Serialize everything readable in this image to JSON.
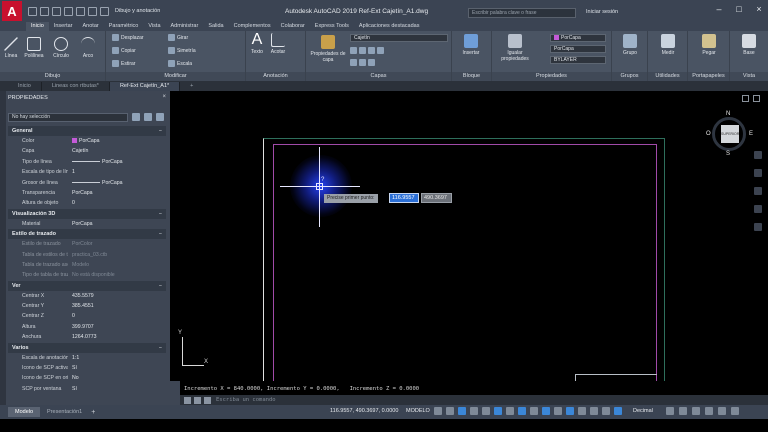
{
  "titlebar": {
    "logo": "A",
    "workspace": "Dibujo y anotación",
    "app_title": "Autodesk AutoCAD 2019   Ref-Ext Cajetín_A1.dwg",
    "search_placeholder": "Escribir palabra clave o frase",
    "signin": "Iniciar sesión"
  },
  "ribbon_tabs": [
    "Inicio",
    "Insertar",
    "Anotar",
    "Paramétrico",
    "Vista",
    "Administrar",
    "Salida",
    "Complementos",
    "Colaborar",
    "Express Tools",
    "Aplicaciones destacadas"
  ],
  "ribbon": {
    "dibujo": {
      "label": "Dibujo",
      "tools": [
        "Línea",
        "Polilínea",
        "Círculo",
        "Arco"
      ]
    },
    "modificar": {
      "label": "Modificar",
      "tools": [
        "Desplazar",
        "Girar",
        "Copiar",
        "Simetría",
        "Estirar",
        "Escala"
      ]
    },
    "anotacion": {
      "label": "Anotación",
      "tools": [
        "Texto",
        "Acotar"
      ]
    },
    "capas": {
      "label": "Capas",
      "props_btn": "Propiedades de capa",
      "layer_combo": "Cajetín"
    },
    "bloque": {
      "label": "Bloque",
      "tool": "Insertar"
    },
    "propiedades": {
      "label": "Propiedades",
      "tool": "Igualar propiedades",
      "combo1": "PorCapa",
      "combo2": "PorCapa",
      "combo3": "BYLAYER"
    },
    "grupos": {
      "label": "Grupos",
      "tool": "Grupo"
    },
    "utilidades": {
      "label": "Utilidades",
      "tool": "Medir"
    },
    "portapapeles": {
      "label": "Portapapeles",
      "tool": "Pegar"
    },
    "vista": {
      "label": "Vista",
      "tool": "Base"
    }
  },
  "doc_tabs": [
    "Inicio",
    "Lineas con rtbutas*",
    "Ref-Ext Cajetín_A1*"
  ],
  "props": {
    "title": "PROPIEDADES",
    "selection": "No hay selección",
    "sections": [
      {
        "name": "General",
        "rows": [
          {
            "k": "Color",
            "v": "PorCapa"
          },
          {
            "k": "Capa",
            "v": "Cajetín"
          },
          {
            "k": "Tipo de línea",
            "v": "PorCapa"
          },
          {
            "k": "Escala de tipo de línea",
            "v": "1"
          },
          {
            "k": "Grosor de línea",
            "v": "PorCapa"
          },
          {
            "k": "Transparencia",
            "v": "PorCapa"
          },
          {
            "k": "Altura de objeto",
            "v": "0"
          }
        ]
      },
      {
        "name": "Visualización 3D",
        "rows": [
          {
            "k": "Material",
            "v": "PorCapa"
          }
        ]
      },
      {
        "name": "Estilo de trazado",
        "rows": [
          {
            "k": "Estilo de trazado",
            "v": "PorColor"
          },
          {
            "k": "Tabla de estilos de tr...",
            "v": "practica_03.ctb"
          },
          {
            "k": "Tabla de trazado aso...",
            "v": "Modelo"
          },
          {
            "k": "Tipo de tabla de traz...",
            "v": "No está disponible"
          }
        ]
      },
      {
        "name": "Ver",
        "rows": [
          {
            "k": "Centrar X",
            "v": "435.5579"
          },
          {
            "k": "Centrar Y",
            "v": "385.4551"
          },
          {
            "k": "Centrar Z",
            "v": "0"
          },
          {
            "k": "Altura",
            "v": "399.9707"
          },
          {
            "k": "Anchura",
            "v": "1264.0773"
          }
        ]
      },
      {
        "name": "Varios",
        "rows": [
          {
            "k": "Escala de anotación",
            "v": "1:1"
          },
          {
            "k": "Icono de SCP activado",
            "v": "Sí"
          },
          {
            "k": "Icono de SCP en orig...",
            "v": "No"
          },
          {
            "k": "SCP por ventana",
            "v": "Sí"
          }
        ]
      }
    ]
  },
  "canvas": {
    "prompt": "Precise primer punto:",
    "x_value": "116.9557",
    "y_value": "490.3697",
    "viewcube_face": "SUPERIOR",
    "viewcube_n": "N",
    "viewcube_s": "S",
    "viewcube_o": "O",
    "viewcube_e": "E",
    "ucs_x": "X",
    "ucs_y": "Y",
    "cursor_q": "?"
  },
  "command": {
    "history": "Incremento X = 840.0000, Incremento Y = 0.0000,   Incremento Z = 0.0000",
    "placeholder": "Escriba un comando"
  },
  "status": {
    "layout_tabs": [
      "Modelo",
      "Presentación1"
    ],
    "coords": "116.9557, 490.3697, 0.0000",
    "model": "MODELO",
    "units": "Decimal"
  }
}
